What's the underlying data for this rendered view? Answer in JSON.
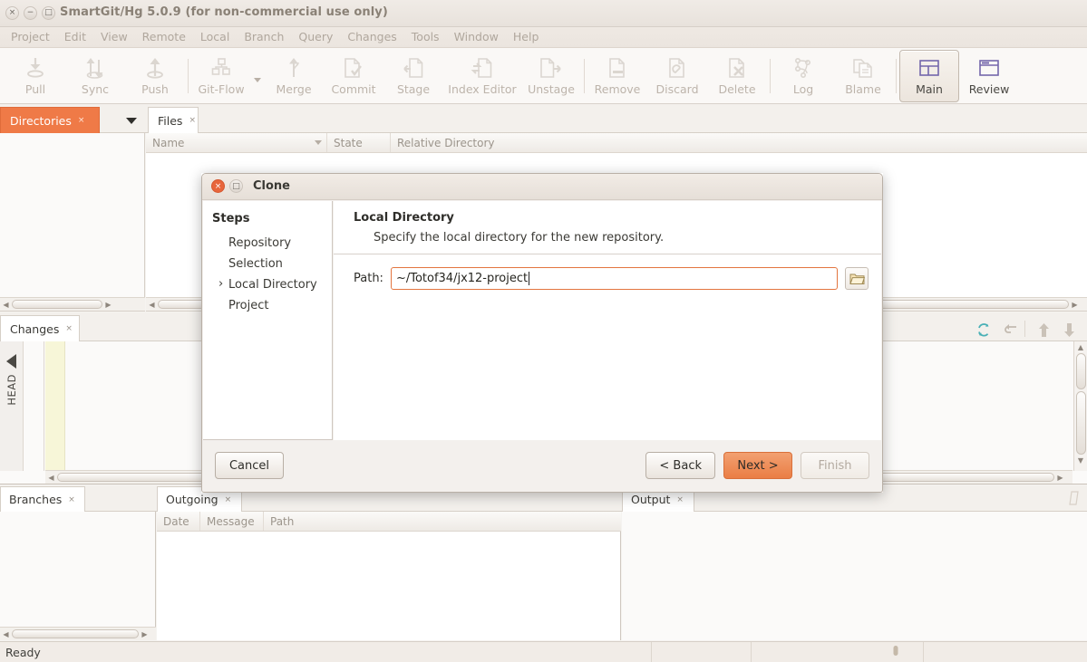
{
  "window": {
    "title": "SmartGit/Hg 5.0.9 (for non-commercial use only)",
    "close_glyph": "×",
    "minimize_glyph": "−",
    "maximize_glyph": "□"
  },
  "menubar": {
    "items": [
      "Project",
      "Edit",
      "View",
      "Remote",
      "Local",
      "Branch",
      "Query",
      "Changes",
      "Tools",
      "Window",
      "Help"
    ]
  },
  "toolbar": {
    "items": [
      {
        "label": "Pull",
        "icon": "pull-icon",
        "enabled": false
      },
      {
        "label": "Sync",
        "icon": "sync-icon",
        "enabled": false
      },
      {
        "label": "Push",
        "icon": "push-icon",
        "enabled": false
      },
      {
        "label": "Git-Flow",
        "icon": "gitflow-icon",
        "enabled": false
      },
      {
        "label": "Merge",
        "icon": "merge-icon",
        "enabled": false
      },
      {
        "label": "Commit",
        "icon": "commit-icon",
        "enabled": false
      },
      {
        "label": "Stage",
        "icon": "stage-icon",
        "enabled": false
      },
      {
        "label": "Index Editor",
        "icon": "index-editor-icon",
        "enabled": false
      },
      {
        "label": "Unstage",
        "icon": "unstage-icon",
        "enabled": false
      },
      {
        "label": "Remove",
        "icon": "remove-icon",
        "enabled": false
      },
      {
        "label": "Discard",
        "icon": "discard-icon",
        "enabled": false
      },
      {
        "label": "Delete",
        "icon": "delete-icon",
        "enabled": false
      },
      {
        "label": "Log",
        "icon": "log-icon",
        "enabled": false
      },
      {
        "label": "Blame",
        "icon": "blame-icon",
        "enabled": false
      },
      {
        "label": "Main",
        "icon": "main-view-icon",
        "enabled": true,
        "active": true
      },
      {
        "label": "Review",
        "icon": "review-view-icon",
        "enabled": true
      }
    ]
  },
  "tabs": {
    "directories": {
      "label": "Directories",
      "close": "×"
    },
    "files": {
      "label": "Files",
      "close": "×"
    },
    "changes": {
      "label": "Changes",
      "close": "×"
    },
    "branches": {
      "label": "Branches",
      "close": "×"
    },
    "outgoing": {
      "label": "Outgoing",
      "close": "×"
    },
    "output": {
      "label": "Output",
      "close": "×"
    }
  },
  "search": {
    "value": "",
    "placeholder": ""
  },
  "files_table": {
    "columns": [
      "Name",
      "State",
      "Relative Directory"
    ],
    "rows": []
  },
  "outgoing_table": {
    "columns": [
      "Date",
      "Message",
      "Path"
    ],
    "rows": []
  },
  "changes_panel": {
    "head_label": "HEAD"
  },
  "status_bar": {
    "text": "Ready"
  },
  "dialog": {
    "title": "Clone",
    "close_glyph": "×",
    "max_glyph": "□",
    "steps_title": "Steps",
    "steps": [
      {
        "label": "Repository",
        "current": false
      },
      {
        "label": "Selection",
        "current": false
      },
      {
        "label": "Local Directory",
        "current": true
      },
      {
        "label": "Project",
        "current": false
      }
    ],
    "heading": "Local Directory",
    "subheading": "Specify the local directory for the new repository.",
    "path_label": "Path:",
    "path_value": "~/Totof34/jx12-project",
    "browse_icon": "folder-icon",
    "buttons": {
      "cancel": "Cancel",
      "back": "< Back",
      "next": "Next >",
      "finish": "Finish"
    }
  },
  "colors": {
    "accent_orange": "#ef7a47",
    "dialog_primary": "#ea7e45",
    "window_bg": "#f5f3f0",
    "title_text": "#8a8176"
  }
}
